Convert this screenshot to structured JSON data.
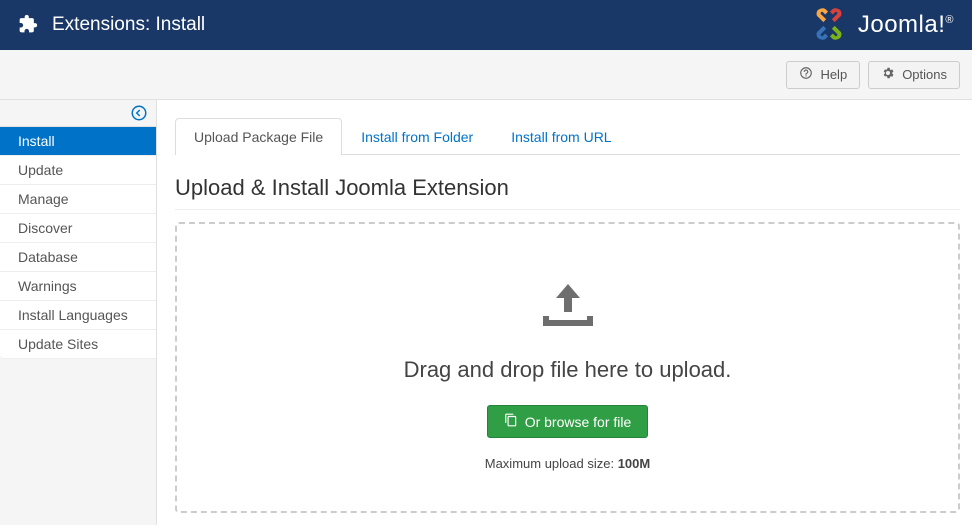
{
  "header": {
    "title": "Extensions: Install",
    "brand": "Joomla!"
  },
  "toolbar": {
    "help": "Help",
    "options": "Options"
  },
  "sidebar": {
    "items": [
      "Install",
      "Update",
      "Manage",
      "Discover",
      "Database",
      "Warnings",
      "Install Languages",
      "Update Sites"
    ],
    "activeIndex": 0
  },
  "tabs": {
    "items": [
      "Upload Package File",
      "Install from Folder",
      "Install from URL"
    ],
    "activeIndex": 0
  },
  "section": {
    "heading": "Upload & Install Joomla Extension",
    "dropText": "Drag and drop file here to upload.",
    "browseLabel": "Or browse for file",
    "maxPrefix": "Maximum upload size: ",
    "maxSize": "100M"
  }
}
